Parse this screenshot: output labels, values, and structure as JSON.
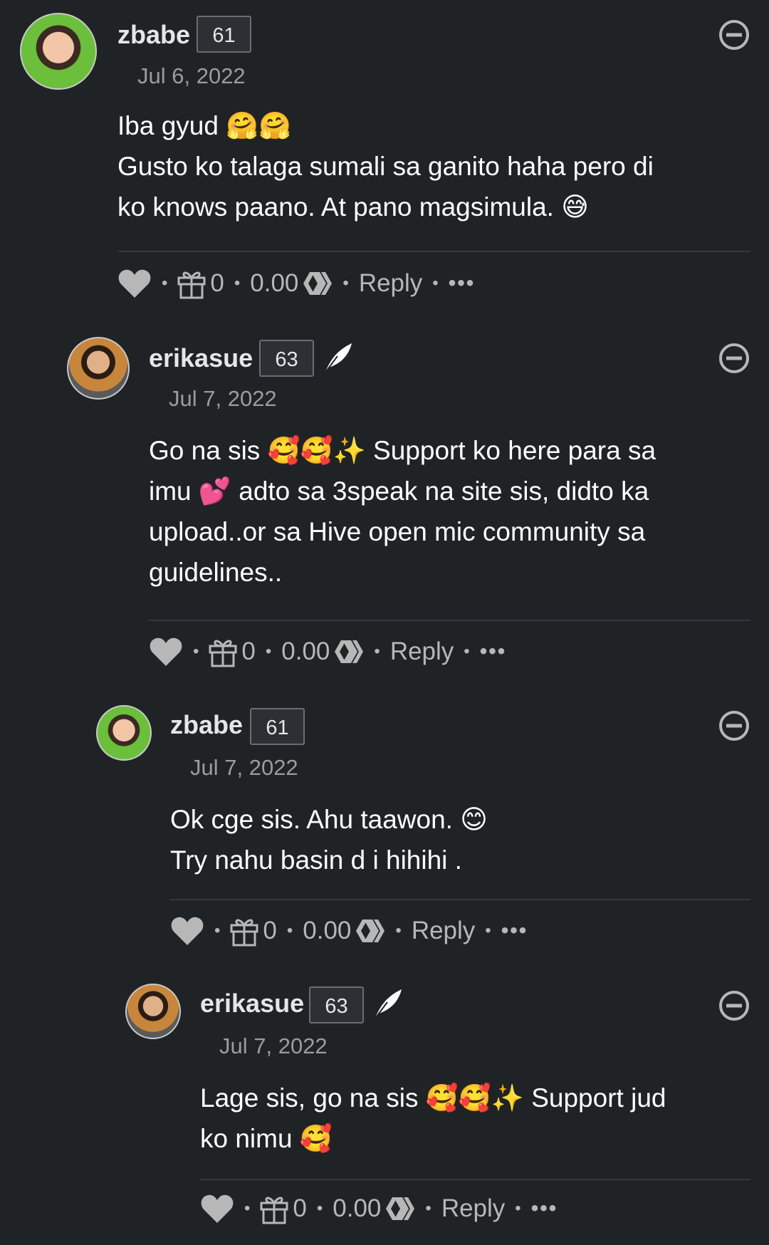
{
  "comments": [
    {
      "author": "zbabe",
      "reputation": "61",
      "date": "Jul 6, 2022",
      "lines": [
        "Iba gyud 🤗🤗",
        "Gusto ko talaga sumali sa ganito haha pero di",
        "ko knows paano. At pano magsimula. 😅"
      ],
      "gift_count": "0",
      "payout": "0.00",
      "reply_label": "Reply",
      "more_label": "•••"
    },
    {
      "author": "erikasue",
      "reputation": "63",
      "date": "Jul 7, 2022",
      "lines": [
        "Go na sis 🥰🥰✨ Support ko here para sa",
        "imu 💕 adto sa 3speak na site sis, didto ka",
        "upload..or sa Hive open mic community sa",
        "guidelines.."
      ],
      "gift_count": "0",
      "payout": "0.00",
      "reply_label": "Reply",
      "more_label": "•••"
    },
    {
      "author": "zbabe",
      "reputation": "61",
      "date": "Jul 7, 2022",
      "lines": [
        "Ok cge sis. Ahu taawon. 😊",
        "Try nahu basin d i hihihi ."
      ],
      "gift_count": "0",
      "payout": "0.00",
      "reply_label": "Reply",
      "more_label": "•••"
    },
    {
      "author": "erikasue",
      "reputation": "63",
      "date": "Jul 7, 2022",
      "lines": [
        "Lage sis, go na sis 🥰🥰✨ Support jud",
        "ko nimu 🥰"
      ],
      "gift_count": "0",
      "payout": "0.00",
      "reply_label": "Reply",
      "more_label": "•••"
    }
  ],
  "icons": {
    "like": "heart-icon",
    "gift": "gift-icon",
    "currency": "hive-icon",
    "collapse": "minus-circle-icon",
    "feather": "feather-icon"
  },
  "colors": {
    "background": "#1f2326",
    "muted": "#9c9c9c",
    "action": "#b7b7b7"
  }
}
